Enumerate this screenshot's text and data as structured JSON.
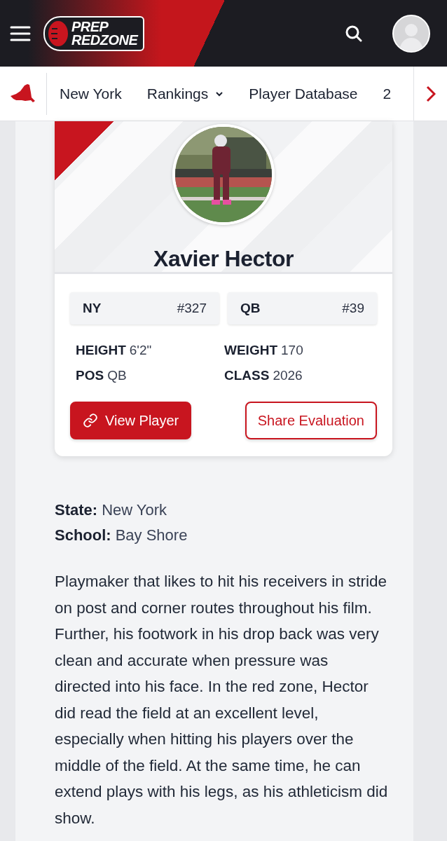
{
  "header": {
    "logo": {
      "line_1": "PREP",
      "line_2": "REDZONE"
    }
  },
  "nav": {
    "items": [
      {
        "label": "New York",
        "dropdown": false
      },
      {
        "label": "Rankings",
        "dropdown": true
      },
      {
        "label": "Player Database",
        "dropdown": false
      },
      {
        "label": "2",
        "dropdown": false
      }
    ]
  },
  "player": {
    "name": "Xavier Hector",
    "ranks": [
      {
        "label": "NY",
        "rank": "#327"
      },
      {
        "label": "QB",
        "rank": "#39"
      }
    ],
    "stats": [
      {
        "label": "HEIGHT",
        "value": "6'2\""
      },
      {
        "label": "WEIGHT",
        "value": "170"
      },
      {
        "label": "POS",
        "value": "QB"
      },
      {
        "label": "CLASS",
        "value": "2026"
      }
    ],
    "actions": [
      {
        "label": "View Player",
        "kind": "primary"
      },
      {
        "label": "Share Evaluation",
        "kind": "outline"
      }
    ]
  },
  "details": [
    {
      "label": "State:",
      "value": "New York"
    },
    {
      "label": "School:",
      "value": "Bay Shore"
    }
  ],
  "evaluation": "Playmaker that likes to hit his receivers in stride on post and corner routes throughout his film. Further, his footwork in his drop back was very clean and accurate when pressure was directed into his face. In the red zone, Hector did read the field at an excellent level, especially when hitting his players over the middle of the field. At the same time, he can extend plays with his legs, as his athleticism did show."
}
